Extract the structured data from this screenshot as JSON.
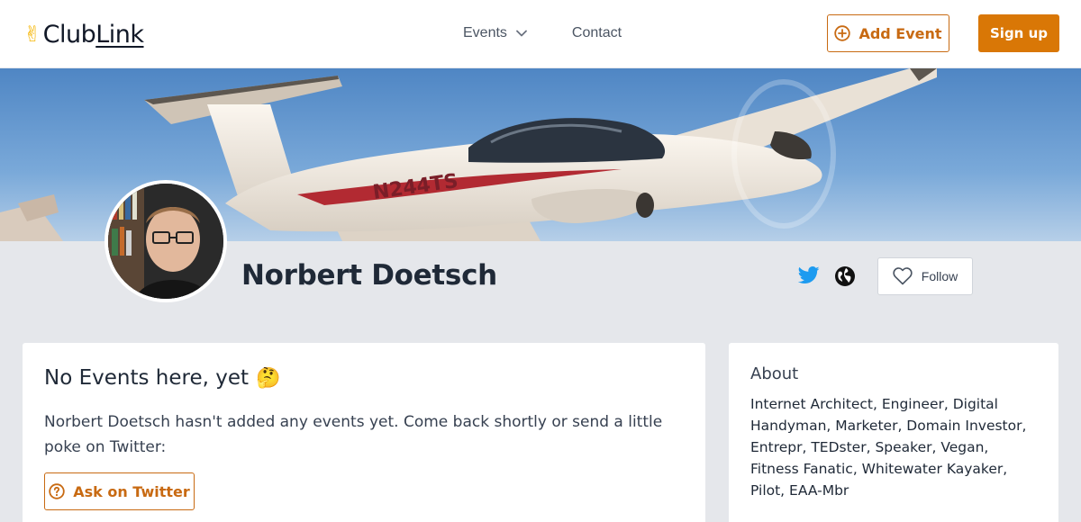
{
  "header": {
    "logo_prefix": "Club",
    "logo_suffix": "Link",
    "nav": {
      "events_label": "Events",
      "contact_label": "Contact"
    },
    "add_event_label": "Add Event",
    "signup_label": "Sign up"
  },
  "banner": {
    "tail_number": "N244TS"
  },
  "profile": {
    "name": "Norbert Doetsch",
    "follow_label": "Follow",
    "social_icons": [
      "twitter-icon",
      "globe-icon"
    ]
  },
  "events": {
    "title": "No Events here, yet",
    "title_emoji": "🤔",
    "message": "Norbert Doetsch hasn't added any events yet. Come back shortly or send a little poke on Twitter:",
    "ask_button_label": "Ask on Twitter"
  },
  "about": {
    "title": "About",
    "text": "Internet Architect, Engineer, Digital Handyman, Marketer, Domain Investor, Entrepr, TEDster, Speaker, Vegan, Fitness Fanatic, Whitewater Kayaker, Pilot, EAA-Mbr"
  },
  "colors": {
    "accent": "#d97706",
    "accent_outline": "#c86a12",
    "twitter": "#1d9bf0",
    "page_bg": "#e5e7eb"
  }
}
